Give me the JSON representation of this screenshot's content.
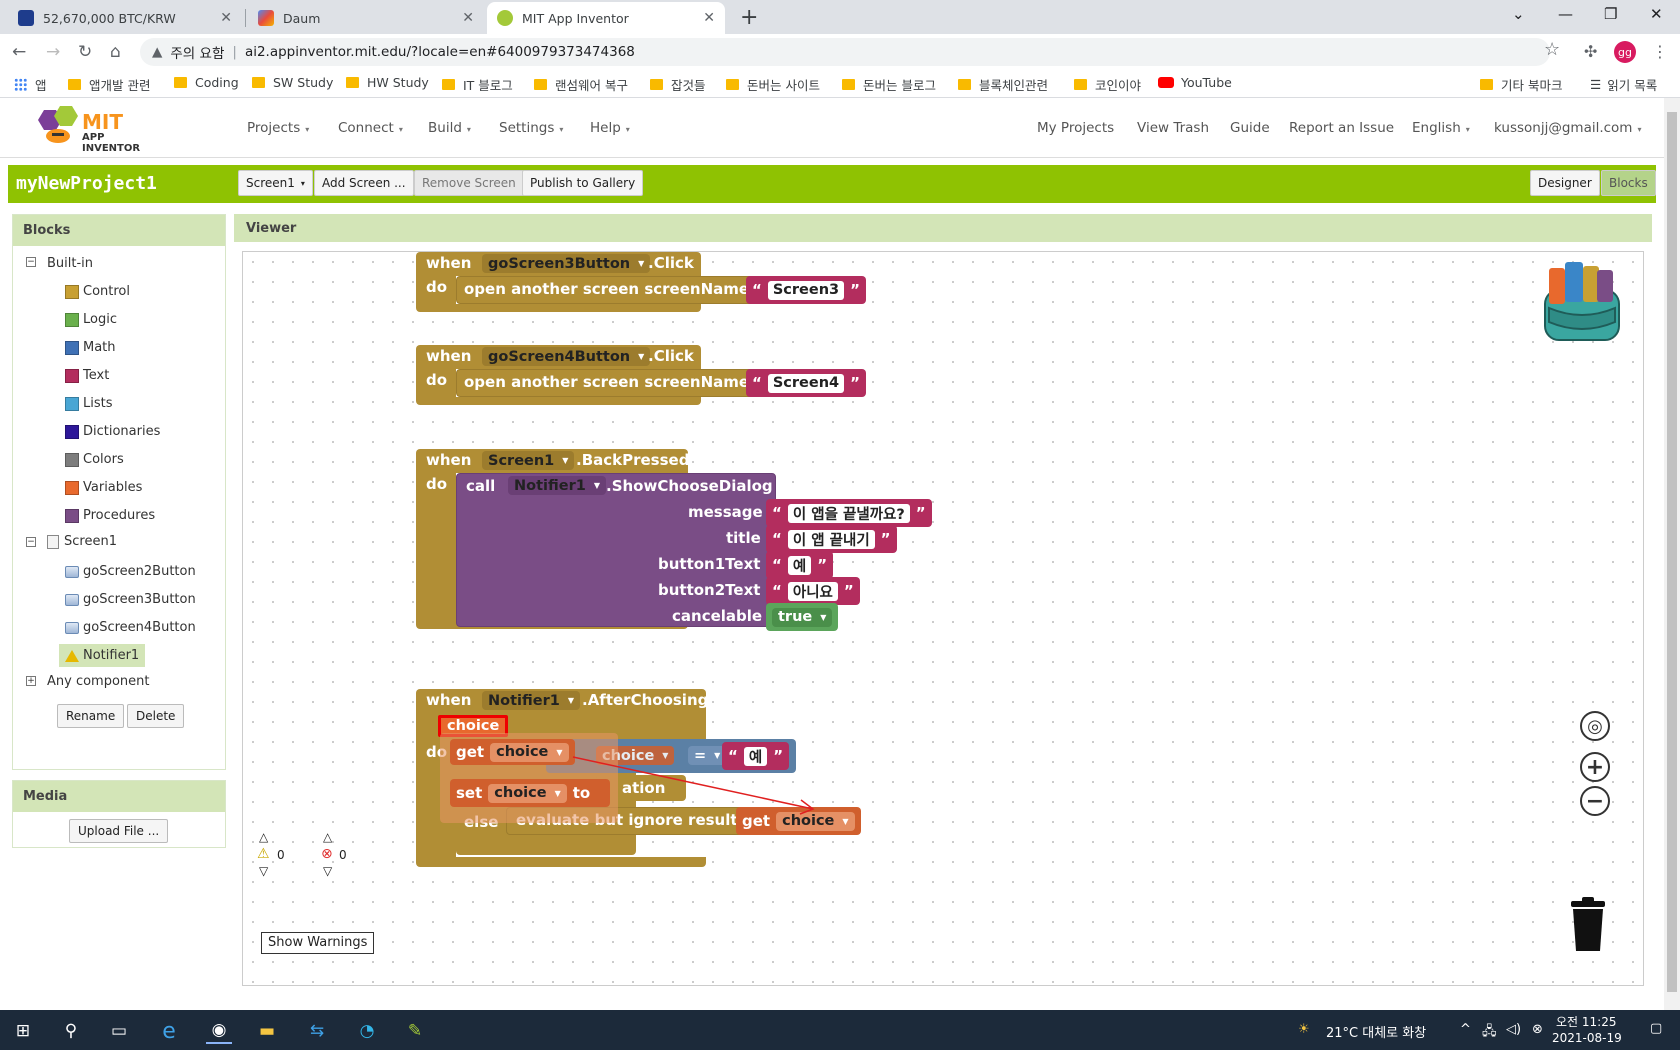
{
  "browser": {
    "tabs": [
      {
        "title": "52,670,000 BTC/KRW",
        "active": false
      },
      {
        "title": "Daum",
        "active": false
      },
      {
        "title": "MIT App Inventor",
        "active": true
      }
    ],
    "address": {
      "security": "주의 요함",
      "url": "ai2.appinventor.mit.edu/?locale=en#6400979373474368"
    },
    "profile_initials": "gg",
    "bookmarks": [
      "앱",
      "앱개발 관련",
      "Coding",
      "SW Study",
      "HW Study",
      "IT 블로그",
      "랜섬웨어 복구",
      "잡것들",
      "돈버는 사이트",
      "돈버는 블로그",
      "블록체인관련",
      "코인이야",
      "YouTube",
      "기타 북마크",
      "읽기 목록"
    ]
  },
  "app": {
    "logo": {
      "line1": "MIT",
      "line2": "APP INVENTOR"
    },
    "menus": [
      "Projects",
      "Connect",
      "Build",
      "Settings",
      "Help"
    ],
    "right_links": [
      "My Projects",
      "View Trash",
      "Guide",
      "Report an Issue",
      "English",
      "kussonjj@gmail.com"
    ]
  },
  "project": {
    "name": "myNewProject1",
    "buttons": {
      "screen": "Screen1",
      "add_screen": "Add Screen ...",
      "remove_screen": "Remove Screen",
      "publish": "Publish to Gallery",
      "designer": "Designer",
      "blocks": "Blocks"
    }
  },
  "blocks_panel": {
    "title": "Blocks",
    "builtin_label": "Built-in",
    "builtin": [
      {
        "label": "Control",
        "color": "#c8a033"
      },
      {
        "label": "Logic",
        "color": "#6ab04c"
      },
      {
        "label": "Math",
        "color": "#3f71b5"
      },
      {
        "label": "Text",
        "color": "#b32d5e"
      },
      {
        "label": "Lists",
        "color": "#49a6d4"
      },
      {
        "label": "Dictionaries",
        "color": "#2d1799"
      },
      {
        "label": "Colors",
        "color": "#7d7d7d"
      },
      {
        "label": "Variables",
        "color": "#e8692d"
      },
      {
        "label": "Procedures",
        "color": "#7a4d86"
      }
    ],
    "screen_label": "Screen1",
    "components": [
      "goScreen2Button",
      "goScreen3Button",
      "goScreen4Button",
      "Notifier1"
    ],
    "any_component": "Any component",
    "rename": "Rename",
    "delete": "Delete"
  },
  "media_panel": {
    "title": "Media",
    "upload": "Upload File ..."
  },
  "viewer": {
    "title": "Viewer",
    "warnings_count": "0",
    "errors_count": "0",
    "show_warnings": "Show Warnings",
    "block1": {
      "when": "when",
      "component": "goScreen3Button",
      "event": ".Click",
      "do": "do",
      "action": "open another screen screenName",
      "value": "Screen3"
    },
    "block2": {
      "when": "when",
      "component": "goScreen4Button",
      "event": ".Click",
      "do": "do",
      "action": "open another screen screenName",
      "value": "Screen4"
    },
    "block3": {
      "when": "when",
      "component": "Screen1",
      "event": ".BackPressed",
      "do": "do",
      "call": "call",
      "notifier": "Notifier1",
      "method": ".ShowChooseDialog",
      "params": [
        {
          "label": "message",
          "value": "이 앱을 끝낼까요?"
        },
        {
          "label": "title",
          "value": "이 앱 끝내기"
        },
        {
          "label": "button1Text",
          "value": "예"
        },
        {
          "label": "button2Text",
          "value": "아니요"
        },
        {
          "label": "cancelable",
          "value": "true"
        }
      ]
    },
    "block4": {
      "when": "when",
      "component": "Notifier1",
      "event": ".AfterChoosing",
      "param": "choice",
      "do": "do",
      "get": "get",
      "set": "set",
      "to": "to",
      "var": "choice",
      "partial_if_var": "choice",
      "eq": "=",
      "eq_value": "예",
      "partial_text": "ation",
      "else": "else",
      "evaluate": "evaluate but ignore result"
    }
  },
  "taskbar": {
    "weather": "21°C 대체로 화창",
    "time": "오전 11:25",
    "date": "2021-08-19"
  }
}
